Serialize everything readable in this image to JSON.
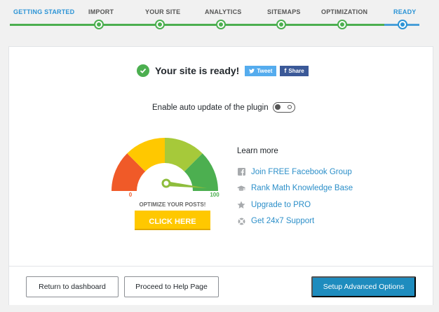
{
  "steps": [
    {
      "label": "GETTING STARTED",
      "state": "done"
    },
    {
      "label": "IMPORT",
      "state": "done"
    },
    {
      "label": "YOUR SITE",
      "state": "done"
    },
    {
      "label": "ANALYTICS",
      "state": "done"
    },
    {
      "label": "SITEMAPS",
      "state": "done"
    },
    {
      "label": "OPTIMIZATION",
      "state": "done"
    },
    {
      "label": "READY",
      "state": "active"
    }
  ],
  "colors": {
    "progress_green": "#4caf50",
    "accent_blue": "#2c94d6",
    "link_blue": "#2c8fc9",
    "primary_button": "#1e8cbe",
    "twitter": "#55acee",
    "facebook": "#3b5998"
  },
  "ready": {
    "title": "Your site is ready!",
    "tweet_label": "Tweet",
    "share_label": "Share"
  },
  "auto_update": {
    "label": "Enable auto update of the plugin",
    "enabled": false
  },
  "gauge": {
    "min_label": "0",
    "max_label": "100",
    "caption": "OPTIMIZE YOUR POSTS!",
    "button_label": "CLICK HERE"
  },
  "learn_more": {
    "title": "Learn more",
    "links": [
      {
        "label": "Join FREE Facebook Group",
        "icon": "facebook-icon"
      },
      {
        "label": "Rank Math Knowledge Base",
        "icon": "graduation-cap-icon"
      },
      {
        "label": "Upgrade to PRO",
        "icon": "star-icon"
      },
      {
        "label": "Get 24x7 Support",
        "icon": "lifebuoy-icon"
      }
    ]
  },
  "footer": {
    "dashboard_label": "Return to dashboard",
    "help_label": "Proceed to Help Page",
    "advanced_label": "Setup Advanced Options"
  }
}
